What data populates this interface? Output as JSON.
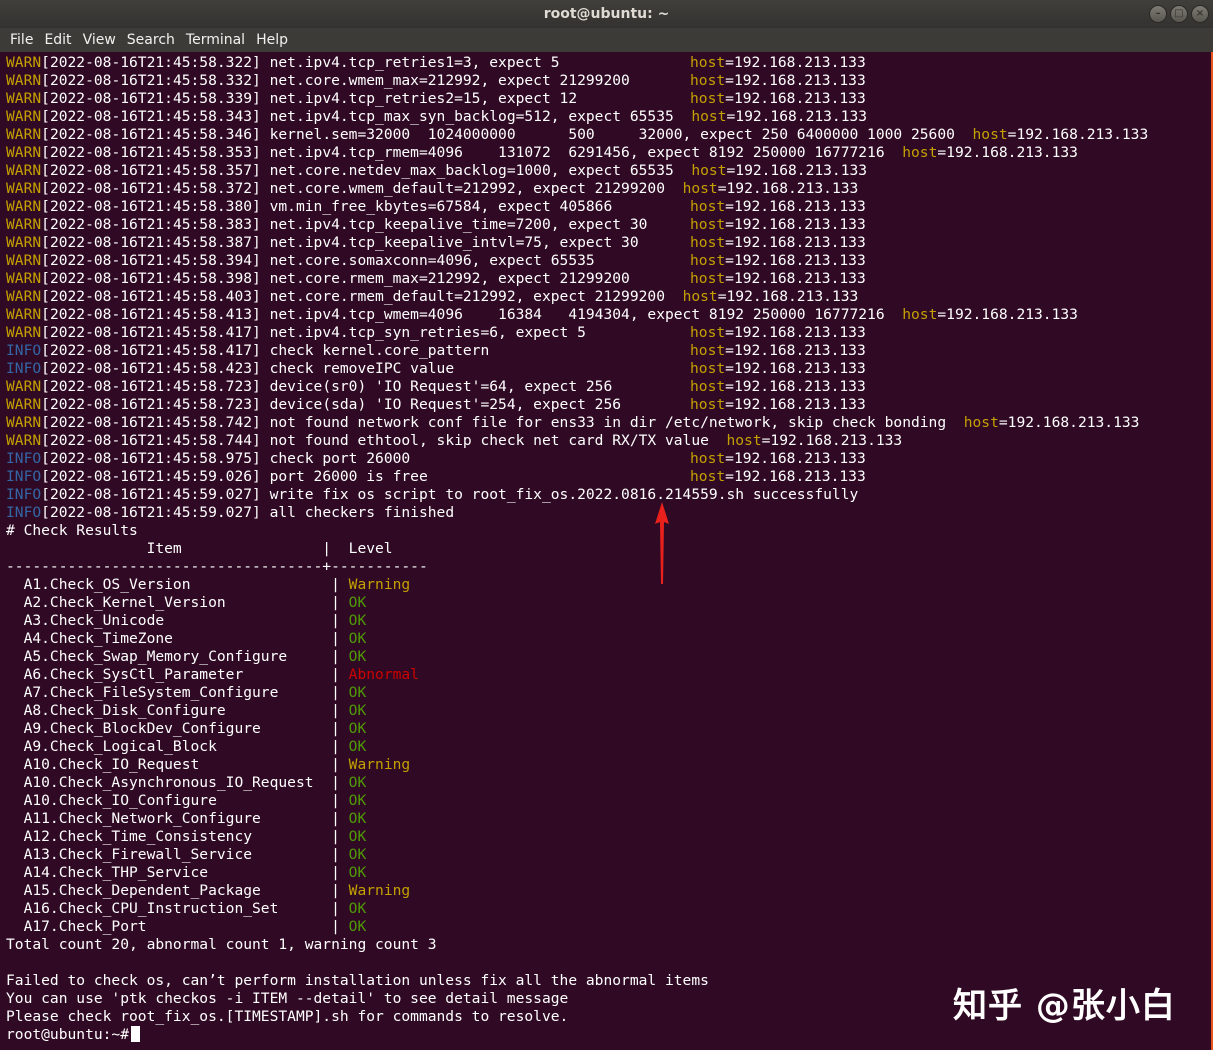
{
  "window": {
    "title": "root@ubuntu: ~",
    "buttons": [
      "–",
      "□",
      "×"
    ]
  },
  "menu": [
    "File",
    "Edit",
    "View",
    "Search",
    "Terminal",
    "Help"
  ],
  "log": [
    {
      "level": "WARN",
      "ts": "[2022-08-16T21:45:58.322]",
      "msg": " net.ipv4.tcp_retries1=3, expect 5",
      "col": 76
    },
    {
      "level": "WARN",
      "ts": "[2022-08-16T21:45:58.332]",
      "msg": " net.core.wmem_max=212992, expect 21299200",
      "col": 76
    },
    {
      "level": "WARN",
      "ts": "[2022-08-16T21:45:58.339]",
      "msg": " net.ipv4.tcp_retries2=15, expect 12",
      "col": 76
    },
    {
      "level": "WARN",
      "ts": "[2022-08-16T21:45:58.343]",
      "msg": " net.ipv4.tcp_max_syn_backlog=512, expect 65535  ",
      "col": null
    },
    {
      "level": "WARN",
      "ts": "[2022-08-16T21:45:58.346]",
      "msg": " kernel.sem=32000  1024000000      500     32000, expect 250 6400000 1000 25600  ",
      "col": null
    },
    {
      "level": "WARN",
      "ts": "[2022-08-16T21:45:58.353]",
      "msg": " net.ipv4.tcp_rmem=4096    131072  6291456, expect 8192 250000 16777216  ",
      "col": null
    },
    {
      "level": "WARN",
      "ts": "[2022-08-16T21:45:58.357]",
      "msg": " net.core.netdev_max_backlog=1000, expect 65535  ",
      "col": null
    },
    {
      "level": "WARN",
      "ts": "[2022-08-16T21:45:58.372]",
      "msg": " net.core.wmem_default=212992, expect 21299200  ",
      "col": null
    },
    {
      "level": "WARN",
      "ts": "[2022-08-16T21:45:58.380]",
      "msg": " vm.min_free_kbytes=67584, expect 405866",
      "col": 76
    },
    {
      "level": "WARN",
      "ts": "[2022-08-16T21:45:58.383]",
      "msg": " net.ipv4.tcp_keepalive_time=7200, expect 30",
      "col": 76
    },
    {
      "level": "WARN",
      "ts": "[2022-08-16T21:45:58.387]",
      "msg": " net.ipv4.tcp_keepalive_intvl=75, expect 30",
      "col": 76
    },
    {
      "level": "WARN",
      "ts": "[2022-08-16T21:45:58.394]",
      "msg": " net.core.somaxconn=4096, expect 65535",
      "col": 76
    },
    {
      "level": "WARN",
      "ts": "[2022-08-16T21:45:58.398]",
      "msg": " net.core.rmem_max=212992, expect 21299200",
      "col": 76
    },
    {
      "level": "WARN",
      "ts": "[2022-08-16T21:45:58.403]",
      "msg": " net.core.rmem_default=212992, expect 21299200  ",
      "col": null
    },
    {
      "level": "WARN",
      "ts": "[2022-08-16T21:45:58.413]",
      "msg": " net.ipv4.tcp_wmem=4096    16384   4194304, expect 8192 250000 16777216  ",
      "col": null
    },
    {
      "level": "WARN",
      "ts": "[2022-08-16T21:45:58.417]",
      "msg": " net.ipv4.tcp_syn_retries=6, expect 5",
      "col": 76
    },
    {
      "level": "INFO",
      "ts": "[2022-08-16T21:45:58.417]",
      "msg": " check kernel.core_pattern",
      "col": 76
    },
    {
      "level": "INFO",
      "ts": "[2022-08-16T21:45:58.423]",
      "msg": " check removeIPC value",
      "col": 76
    },
    {
      "level": "WARN",
      "ts": "[2022-08-16T21:45:58.723]",
      "msg": " device(sr0) 'IO Request'=64, expect 256",
      "col": 76
    },
    {
      "level": "WARN",
      "ts": "[2022-08-16T21:45:58.723]",
      "msg": " device(sda) 'IO Request'=254, expect 256",
      "col": 76
    },
    {
      "level": "WARN",
      "ts": "[2022-08-16T21:45:58.742]",
      "msg": " not found network conf file for ens33 in dir /etc/network, skip check bonding  ",
      "col": null
    },
    {
      "level": "WARN",
      "ts": "[2022-08-16T21:45:58.744]",
      "msg": " not found ethtool, skip check net card RX/TX value  ",
      "col": null
    },
    {
      "level": "INFO",
      "ts": "[2022-08-16T21:45:58.975]",
      "msg": " check port 26000",
      "col": 76
    },
    {
      "level": "INFO",
      "ts": "[2022-08-16T21:45:59.026]",
      "msg": " port 26000 is free",
      "col": 76
    },
    {
      "level": "INFO",
      "ts": "[2022-08-16T21:45:59.027]",
      "msg": " write fix os script to root_fix_os.2022.0816.214559.sh successfully",
      "col": "none"
    },
    {
      "level": "INFO",
      "ts": "[2022-08-16T21:45:59.027]",
      "msg": " all checkers finished",
      "col": "none"
    }
  ],
  "host_label": "host",
  "host_value": "=192.168.213.133",
  "results": {
    "heading": "# Check Results",
    "header": "                Item                |  Level",
    "separator": "------------------------------------+-----------",
    "rows": [
      {
        "item": "  A1.Check_OS_Version                | ",
        "level": "Warning"
      },
      {
        "item": "  A2.Check_Kernel_Version            | ",
        "level": "OK"
      },
      {
        "item": "  A3.Check_Unicode                   | ",
        "level": "OK"
      },
      {
        "item": "  A4.Check_TimeZone                  | ",
        "level": "OK"
      },
      {
        "item": "  A5.Check_Swap_Memory_Configure     | ",
        "level": "OK"
      },
      {
        "item": "  A6.Check_SysCtl_Parameter          | ",
        "level": "Abnormal"
      },
      {
        "item": "  A7.Check_FileSystem_Configure      | ",
        "level": "OK"
      },
      {
        "item": "  A8.Check_Disk_Configure            | ",
        "level": "OK"
      },
      {
        "item": "  A9.Check_BlockDev_Configure        | ",
        "level": "OK"
      },
      {
        "item": "  A9.Check_Logical_Block             | ",
        "level": "OK"
      },
      {
        "item": "  A10.Check_IO_Request               | ",
        "level": "Warning"
      },
      {
        "item": "  A10.Check_Asynchronous_IO_Request  | ",
        "level": "OK"
      },
      {
        "item": "  A10.Check_IO_Configure             | ",
        "level": "OK"
      },
      {
        "item": "  A11.Check_Network_Configure        | ",
        "level": "OK"
      },
      {
        "item": "  A12.Check_Time_Consistency         | ",
        "level": "OK"
      },
      {
        "item": "  A13.Check_Firewall_Service         | ",
        "level": "OK"
      },
      {
        "item": "  A14.Check_THP_Service              | ",
        "level": "OK"
      },
      {
        "item": "  A15.Check_Dependent_Package        | ",
        "level": "Warning"
      },
      {
        "item": "  A16.Check_CPU_Instruction_Set      | ",
        "level": "OK"
      },
      {
        "item": "  A17.Check_Port                     | ",
        "level": "OK"
      }
    ],
    "summary": "Total count 20, abnormal count 1, warning count 3"
  },
  "footer": [
    "",
    "Failed to check os, can’t perform installation unless fix all the abnormal items",
    "You can use 'ptk checkos -i ITEM --detail' to see detail message",
    "Please check root_fix_os.[TIMESTAMP].sh for commands to resolve."
  ],
  "prompt": "root@ubuntu:~#",
  "watermark": "知乎 @张小白",
  "colors": {
    "background": "#300a24",
    "warn": "#c4a000",
    "info": "#3465a4",
    "ok": "#4e9a06",
    "abnormal": "#cc0000",
    "arrow": "#e8211d"
  }
}
